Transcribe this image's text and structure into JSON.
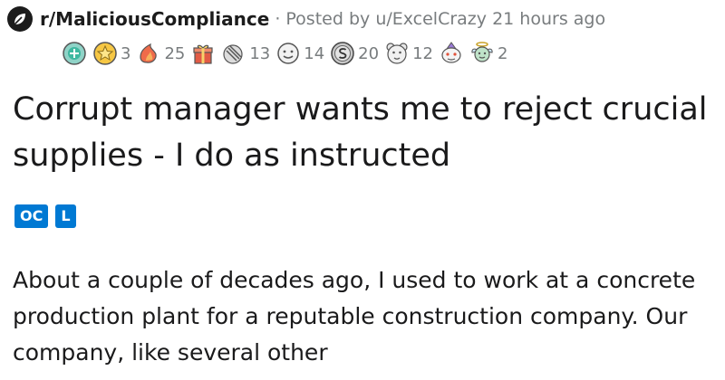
{
  "post": {
    "subreddit": "r/MaliciousCompliance",
    "separator": "·",
    "posted_by_prefix": "Posted by",
    "author": "u/ExcelCrazy",
    "time": "21 hours ago",
    "title": "Corrupt manager wants me to reject crucial supplies - I do as instructed",
    "flairs": [
      "OC",
      "L"
    ],
    "body": "About a couple of decades ago, I used to work at a concrete production plant for a reputable construction company. Our company, like several other"
  },
  "awards": [
    {
      "icon": "green-orb-award-icon",
      "count": ""
    },
    {
      "icon": "gold-star-award-icon",
      "count": "3"
    },
    {
      "icon": "take-my-energy-award-icon",
      "count": "25"
    },
    {
      "icon": "gift-box-award-icon",
      "count": ""
    },
    {
      "icon": "facepalm-award-icon",
      "count": "13"
    },
    {
      "icon": "smile-face-award-icon",
      "count": "14"
    },
    {
      "icon": "silver-coin-award-icon",
      "count": "20"
    },
    {
      "icon": "bear-face-award-icon",
      "count": "12"
    },
    {
      "icon": "snoo-party-award-icon",
      "count": ""
    },
    {
      "icon": "angel-award-icon",
      "count": "2"
    }
  ],
  "colors": {
    "flair_bg": "#0079d3",
    "meta_gray": "#787c7e",
    "text": "#1a1a1b"
  }
}
